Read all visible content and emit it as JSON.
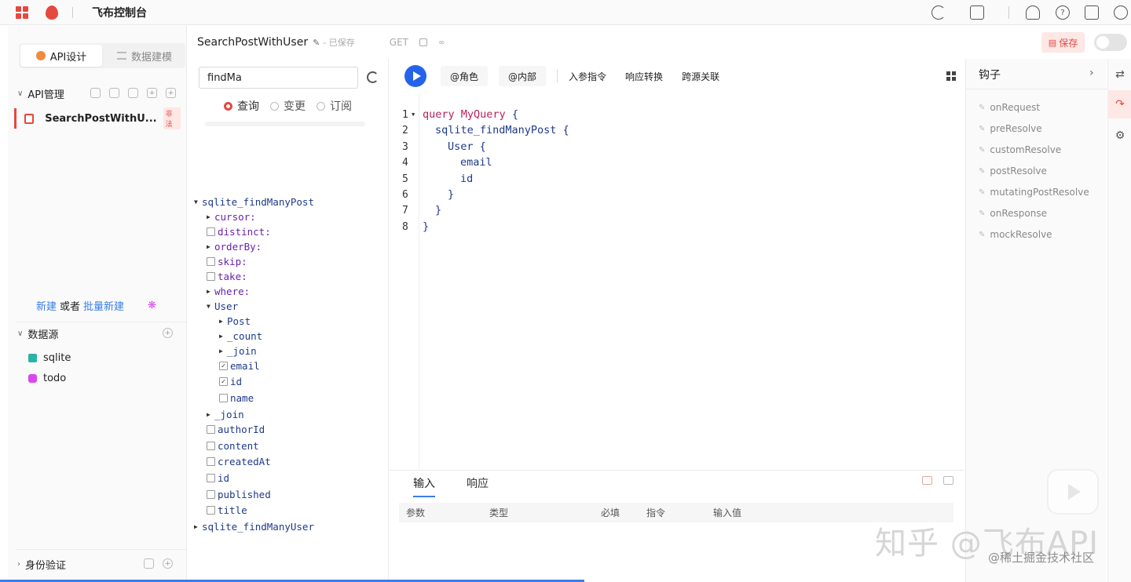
{
  "topbar": {
    "title": "飞布控制台"
  },
  "left": {
    "tabs": [
      {
        "label": "API设计",
        "active": true
      },
      {
        "label": "数据建模",
        "active": false
      }
    ],
    "api_section": "API管理",
    "api_item": {
      "name": "SearchPostWithU...",
      "tag": "非法"
    },
    "new_link": "新建",
    "or_text": "或者",
    "batch_link": "批量新建",
    "datasource_section": "数据源",
    "datasources": [
      {
        "name": "sqlite",
        "color": "#2bb3a6"
      },
      {
        "name": "todo",
        "color": "#d946ef"
      }
    ],
    "auth_section": "身份验证"
  },
  "header": {
    "operation_name": "SearchPostWithUser",
    "saved_status": "- 已保存",
    "method": "GET",
    "save_label": "保存"
  },
  "explorer": {
    "search_value": "findMa",
    "radios": [
      {
        "label": "查询",
        "checked": true
      },
      {
        "label": "变更",
        "checked": false
      },
      {
        "label": "订阅",
        "checked": false
      }
    ],
    "tree": [
      {
        "text": "sqlite_findManyPost",
        "kind": "arrow-open",
        "depth": 0,
        "cls": "c-root"
      },
      {
        "text": "cursor:",
        "kind": "arrow",
        "depth": 1,
        "cls": "c-arg"
      },
      {
        "text": "distinct:",
        "kind": "cb",
        "depth": 1,
        "cls": "c-arg"
      },
      {
        "text": "orderBy:",
        "kind": "arrow",
        "depth": 1,
        "cls": "c-arg"
      },
      {
        "text": "skip:",
        "kind": "cb",
        "depth": 1,
        "cls": "c-arg"
      },
      {
        "text": "take:",
        "kind": "cb",
        "depth": 1,
        "cls": "c-arg"
      },
      {
        "text": "where:",
        "kind": "arrow",
        "depth": 1,
        "cls": "c-arg"
      },
      {
        "text": "User",
        "kind": "arrow-open",
        "depth": 1,
        "cls": "c-field"
      },
      {
        "text": "Post",
        "kind": "arrow",
        "depth": 2,
        "cls": "c-field"
      },
      {
        "text": "_count",
        "kind": "arrow",
        "depth": 2,
        "cls": "c-field"
      },
      {
        "text": "_join",
        "kind": "arrow",
        "depth": 2,
        "cls": "c-field"
      },
      {
        "text": "email",
        "kind": "cb-checked",
        "depth": 2,
        "cls": "c-field"
      },
      {
        "text": "id",
        "kind": "cb-checked",
        "depth": 2,
        "cls": "c-field"
      },
      {
        "text": "name",
        "kind": "cb",
        "depth": 2,
        "cls": "c-field"
      },
      {
        "text": "_join",
        "kind": "arrow",
        "depth": 1,
        "cls": "c-field"
      },
      {
        "text": "authorId",
        "kind": "cb",
        "depth": 1,
        "cls": "c-field"
      },
      {
        "text": "content",
        "kind": "cb",
        "depth": 1,
        "cls": "c-field"
      },
      {
        "text": "createdAt",
        "kind": "cb",
        "depth": 1,
        "cls": "c-field"
      },
      {
        "text": "id",
        "kind": "cb",
        "depth": 1,
        "cls": "c-field"
      },
      {
        "text": "published",
        "kind": "cb",
        "depth": 1,
        "cls": "c-field"
      },
      {
        "text": "title",
        "kind": "cb",
        "depth": 1,
        "cls": "c-field"
      },
      {
        "text": "sqlite_findManyUser",
        "kind": "arrow",
        "depth": 0,
        "cls": "c-root"
      }
    ]
  },
  "toolbar": {
    "buttons": [
      "@角色",
      "@内部"
    ],
    "actions": [
      "入参指令",
      "响应转换",
      "跨源关联"
    ]
  },
  "editor": {
    "lines": [
      {
        "n": "1",
        "indent": 0,
        "parts": [
          [
            "kw",
            "query "
          ],
          [
            "fn",
            "MyQuery"
          ],
          [
            "",
            " {"
          ]
        ]
      },
      {
        "n": "2",
        "indent": 1,
        "parts": [
          [
            "",
            "sqlite_findManyPost {"
          ]
        ]
      },
      {
        "n": "3",
        "indent": 2,
        "parts": [
          [
            "",
            "User {"
          ]
        ]
      },
      {
        "n": "4",
        "indent": 3,
        "parts": [
          [
            "",
            "email"
          ]
        ]
      },
      {
        "n": "5",
        "indent": 3,
        "parts": [
          [
            "",
            "id"
          ]
        ]
      },
      {
        "n": "6",
        "indent": 2,
        "parts": [
          [
            "",
            "}"
          ]
        ]
      },
      {
        "n": "7",
        "indent": 1,
        "parts": [
          [
            "",
            "}"
          ]
        ]
      },
      {
        "n": "8",
        "indent": 0,
        "parts": [
          [
            "",
            "}"
          ]
        ]
      }
    ]
  },
  "bottom": {
    "tabs": [
      {
        "label": "输入",
        "active": true
      },
      {
        "label": "响应",
        "active": false
      }
    ],
    "columns": [
      "参数",
      "类型",
      "必填",
      "指令",
      "输入值"
    ]
  },
  "hooks": {
    "title": "钩子",
    "items": [
      "onRequest",
      "preResolve",
      "customResolve",
      "postResolve",
      "mutatingPostResolve",
      "onResponse",
      "mockResolve"
    ]
  },
  "watermark": {
    "main": "知乎 @飞布API",
    "sub": "@稀土掘金技术社区"
  }
}
